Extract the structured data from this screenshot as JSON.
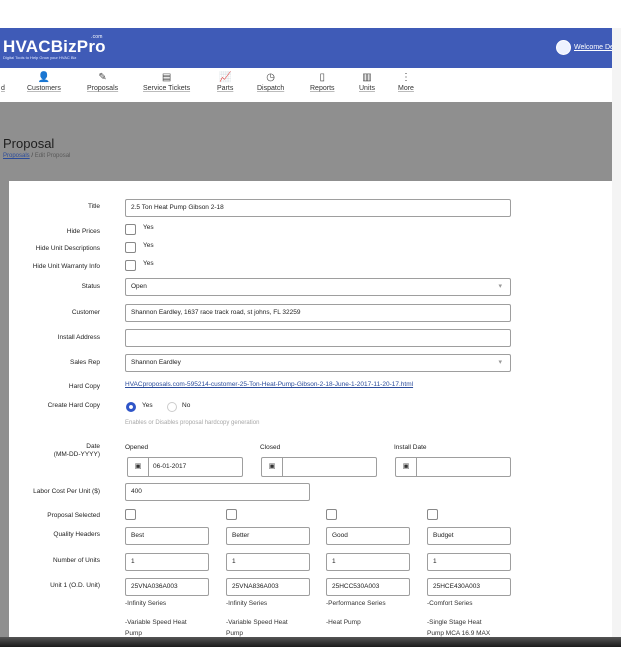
{
  "brand": {
    "name": "HVACBizPro",
    "com": ".com",
    "tagline": "Digital Tools to Help Grow your HVAC Biz"
  },
  "user": {
    "welcome": "Welcome De"
  },
  "nav": [
    {
      "label": "d",
      "icon": "dashboard-icon",
      "glyph": ""
    },
    {
      "label": "Customers",
      "icon": "customers-icon",
      "glyph": "👤"
    },
    {
      "label": "Proposals",
      "icon": "proposals-icon",
      "glyph": "✎"
    },
    {
      "label": "Service Tickets",
      "icon": "service-tickets-icon",
      "glyph": "▤"
    },
    {
      "label": "Parts",
      "icon": "parts-icon",
      "glyph": "📈"
    },
    {
      "label": "Dispatch",
      "icon": "dispatch-icon",
      "glyph": "◷"
    },
    {
      "label": "Reports",
      "icon": "reports-icon",
      "glyph": "▯"
    },
    {
      "label": "Units",
      "icon": "units-icon",
      "glyph": "▥"
    },
    {
      "label": "More",
      "icon": "more-icon",
      "glyph": "⋮"
    }
  ],
  "page": {
    "title": "Proposal",
    "breadcrumb": {
      "root": "Proposals",
      "sep": "/",
      "current": "Edit Proposal"
    }
  },
  "form": {
    "title": {
      "label": "Title",
      "value": "2.5 Ton Heat Pump Gibson 2-18"
    },
    "hide_prices": {
      "label": "Hide Prices",
      "option": "Yes"
    },
    "hide_unit_desc": {
      "label": "Hide Unit Descriptions",
      "option": "Yes"
    },
    "hide_warranty": {
      "label": "Hide Unit Warranty Info",
      "option": "Yes"
    },
    "status": {
      "label": "Status",
      "value": "Open"
    },
    "customer": {
      "label": "Customer",
      "value": "Shannon Eardley, 1637 race track road, st johns, FL 32259"
    },
    "install_address": {
      "label": "Install Address",
      "value": ""
    },
    "sales_rep": {
      "label": "Sales Rep",
      "value": "Shannon Eardley"
    },
    "hard_copy": {
      "label": "Hard Copy",
      "link": "HVACproposals.com-595214-customer-25-Ton-Heat-Pump-Gibson-2-18-June-1-2017-11-20-17.html"
    },
    "create_hard_copy": {
      "label": "Create Hard Copy",
      "yes": "Yes",
      "no": "No",
      "hint": "Enables or Disables proposal hardcopy generation"
    },
    "date": {
      "label": "Date",
      "format": "(MM-DD-YYYY)",
      "opened_label": "Opened",
      "opened_value": "06-01-2017",
      "closed_label": "Closed",
      "closed_value": "",
      "install_label": "Install Date",
      "install_value": ""
    },
    "labor_cost": {
      "label": "Labor Cost Per Unit ($)",
      "value": "400"
    },
    "proposal_selected": {
      "label": "Proposal Selected"
    },
    "quality_headers": {
      "label": "Quality Headers",
      "values": [
        "Best",
        "Better",
        "Good",
        "Budget"
      ]
    },
    "number_of_units": {
      "label": "Number of Units",
      "values": [
        "1",
        "1",
        "1",
        "1"
      ]
    },
    "unit1": {
      "label": "Unit 1 (O.D. Unit)",
      "values": [
        "25VNA036A003",
        "25VNA836A003",
        "25HCC530A003",
        "25HCE430A003"
      ],
      "series": [
        "-Infinity Series",
        "-Infinity Series",
        "-Performance Series",
        "-Comfort Series"
      ],
      "desc1": [
        "-Variable Speed Heat",
        "-Variable Speed Heat",
        "-Heat Pump",
        "-Single Stage Heat"
      ],
      "desc2": [
        "Pump",
        "Pump",
        "",
        "Pump MCA 16.9 MAX"
      ]
    }
  },
  "colors": {
    "header": "#3f5bb7",
    "background": "#8f8f8f",
    "link": "#2b4c9b",
    "radio": "#2f55c8"
  }
}
